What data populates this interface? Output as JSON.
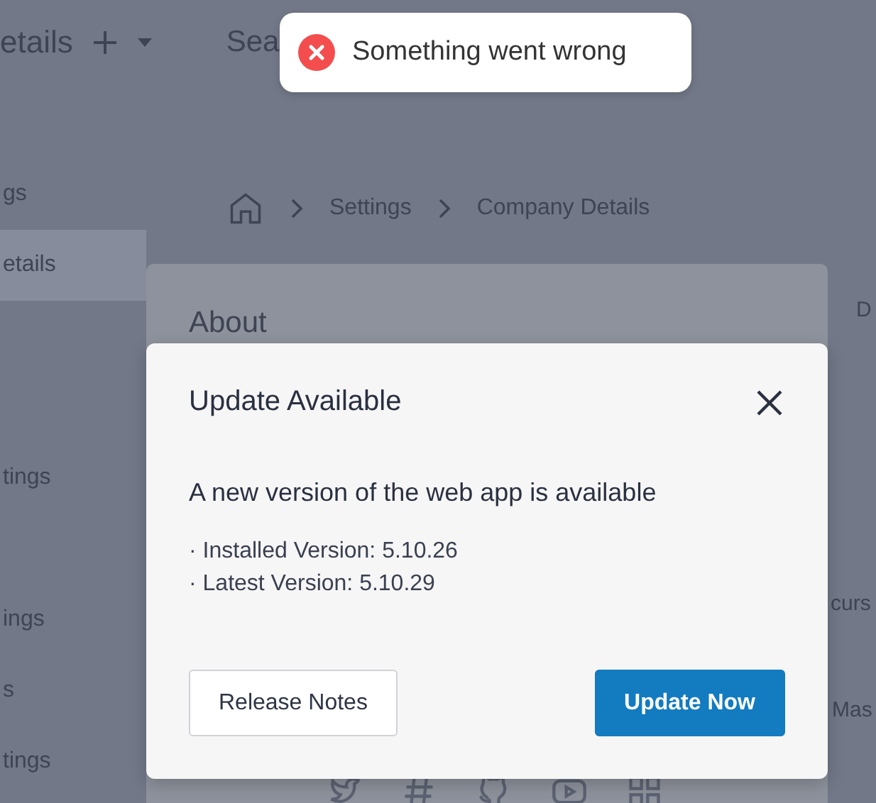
{
  "top_bar": {
    "title": "etails",
    "search_placeholder": "Sea"
  },
  "sidebar": {
    "groups": [
      {
        "items": [
          {
            "label": "gs",
            "selected": false
          },
          {
            "label": "etails",
            "selected": true
          }
        ]
      },
      {
        "items": [
          {
            "label": "tings",
            "selected": false
          }
        ]
      },
      {
        "items": [
          {
            "label": "ings",
            "selected": false
          },
          {
            "label": "s",
            "selected": false
          },
          {
            "label": "tings",
            "selected": false
          }
        ]
      }
    ]
  },
  "breadcrumbs": [
    "Settings",
    "Company Details"
  ],
  "about_card": {
    "title": "About"
  },
  "side_panel": {
    "texts": [
      "D",
      "curs",
      "Mas"
    ]
  },
  "toast": {
    "kind": "error",
    "message": "Something went wrong"
  },
  "dialog": {
    "title": "Update Available",
    "message": "A new version of the web app is available",
    "details": [
      "· Installed Version: 5.10.26",
      "· Latest Version: 5.10.29"
    ],
    "buttons": [
      {
        "label": "Release Notes",
        "kind": "secondary"
      },
      {
        "label": "Update Now",
        "kind": "primary"
      }
    ]
  }
}
